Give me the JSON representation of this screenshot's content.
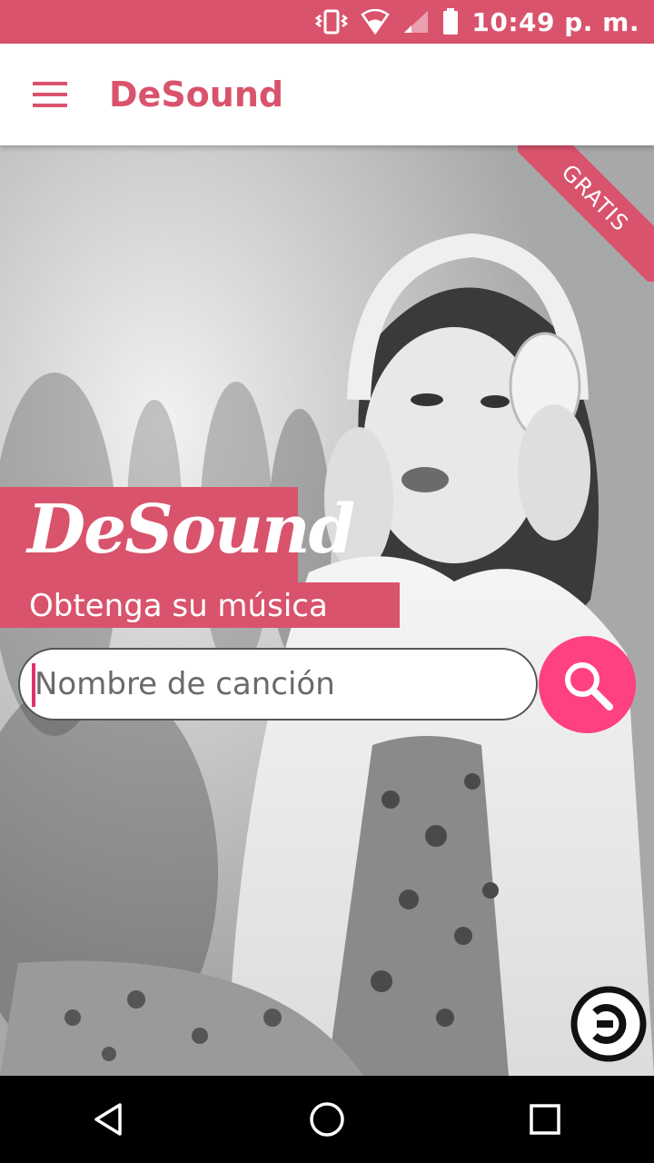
{
  "status_bar": {
    "time": "10:49 p. m.",
    "icons": [
      "vibrate-icon",
      "wifi-icon",
      "signal-icon",
      "battery-icon"
    ]
  },
  "app_bar": {
    "title": "DeSound",
    "menu_icon": "hamburger-menu-icon"
  },
  "hero": {
    "ribbon": "GRATIS",
    "brand": "DeSound",
    "tagline": "Obtenga su música"
  },
  "search": {
    "placeholder": "Nombre de canción",
    "value": "",
    "button_icon": "search-icon"
  },
  "badge": {
    "icon": "copyleft-icon"
  },
  "nav": {
    "icons": [
      "back-icon",
      "home-icon",
      "recents-icon"
    ]
  },
  "colors": {
    "brand": "#d9536c",
    "accent": "#ff4081",
    "caret": "#e0336a"
  }
}
